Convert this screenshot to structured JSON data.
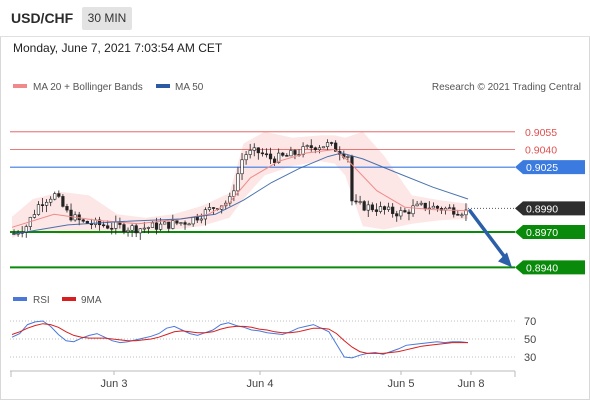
{
  "header": {
    "symbol": "USD/CHF",
    "timeframe_button": "30 MIN",
    "datetime": "Monday, June 7, 2021 7:03:54 AM CET"
  },
  "legend": {
    "ma20_label": "MA 20 + Bollinger Bands",
    "ma20_color": "#f08a8a",
    "ma50_label": "MA 50",
    "ma50_color": "#2c5aa0",
    "credit": "Research © 2021 Trading Central"
  },
  "colors": {
    "resistance": "#e05050",
    "pivot": "#3b7be0",
    "support": "#0a8a0a",
    "last_price": "#333333",
    "band_fill": "#fde2e2",
    "arrow": "#2b5fa8",
    "rsi_line": "#4a78d8",
    "rsi_ma_line": "#d81e1e"
  },
  "chart_data": [
    {
      "type": "candlestick",
      "instrument": "USD/CHF",
      "interval": "30 MIN",
      "x_ticks": [
        "Jun 3",
        "Jun 4",
        "Jun 5",
        "Jun 8"
      ],
      "ylim": [
        0.8925,
        0.9082
      ],
      "levels": [
        {
          "value": "0.9055",
          "kind": "resistance"
        },
        {
          "value": "0.9040",
          "kind": "resistance"
        },
        {
          "value": "0.9025",
          "kind": "pivot"
        },
        {
          "value": "0.8990",
          "kind": "last"
        },
        {
          "value": "0.8970",
          "kind": "support"
        },
        {
          "value": "0.8940",
          "kind": "support"
        }
      ],
      "price_path": [
        [
          0,
          0.8968
        ],
        [
          4,
          0.8975
        ],
        [
          8,
          0.8995
        ],
        [
          12,
          0.9002
        ],
        [
          16,
          0.8985
        ],
        [
          20,
          0.8978
        ],
        [
          28,
          0.8975
        ],
        [
          36,
          0.8973
        ],
        [
          44,
          0.8976
        ],
        [
          50,
          0.8979
        ],
        [
          54,
          0.8985
        ],
        [
          58,
          0.8992
        ],
        [
          62,
          0.8996
        ],
        [
          64,
          0.9015
        ],
        [
          66,
          0.9036
        ],
        [
          70,
          0.9038
        ],
        [
          74,
          0.9032
        ],
        [
          78,
          0.9034
        ],
        [
          82,
          0.9038
        ],
        [
          86,
          0.9043
        ],
        [
          90,
          0.9044
        ],
        [
          92,
          0.9041
        ],
        [
          96,
          0.9035
        ],
        [
          97,
          0.8993
        ],
        [
          100,
          0.8992
        ],
        [
          104,
          0.899
        ],
        [
          108,
          0.8987
        ],
        [
          112,
          0.8986
        ],
        [
          114,
          0.899
        ],
        [
          118,
          0.8992
        ],
        [
          122,
          0.899
        ],
        [
          126,
          0.8989
        ],
        [
          130,
          0.8987
        ]
      ],
      "ma20_path": [
        [
          0,
          0.8974
        ],
        [
          12,
          0.8985
        ],
        [
          24,
          0.898
        ],
        [
          36,
          0.8977
        ],
        [
          48,
          0.8981
        ],
        [
          56,
          0.8985
        ],
        [
          62,
          0.8995
        ],
        [
          68,
          0.9016
        ],
        [
          76,
          0.903
        ],
        [
          84,
          0.9037
        ],
        [
          92,
          0.904
        ],
        [
          96,
          0.903
        ],
        [
          104,
          0.9005
        ],
        [
          112,
          0.8991
        ],
        [
          120,
          0.8989
        ],
        [
          130,
          0.8988
        ]
      ],
      "ma50_path": [
        [
          0,
          0.8968
        ],
        [
          16,
          0.8976
        ],
        [
          32,
          0.8979
        ],
        [
          48,
          0.8981
        ],
        [
          58,
          0.8985
        ],
        [
          66,
          0.8997
        ],
        [
          74,
          0.9012
        ],
        [
          82,
          0.9024
        ],
        [
          90,
          0.9034
        ],
        [
          94,
          0.9037
        ],
        [
          100,
          0.9032
        ],
        [
          110,
          0.902
        ],
        [
          120,
          0.9008
        ],
        [
          130,
          0.8998
        ]
      ],
      "band_upper": [
        [
          0,
          0.8983
        ],
        [
          6,
          0.8998
        ],
        [
          14,
          0.9004
        ],
        [
          22,
          0.9001
        ],
        [
          30,
          0.8985
        ],
        [
          38,
          0.8982
        ],
        [
          46,
          0.8985
        ],
        [
          54,
          0.8992
        ],
        [
          62,
          0.9003
        ],
        [
          66,
          0.9045
        ],
        [
          72,
          0.9055
        ],
        [
          80,
          0.905
        ],
        [
          88,
          0.9052
        ],
        [
          92,
          0.9052
        ],
        [
          95,
          0.905
        ],
        [
          100,
          0.9055
        ],
        [
          106,
          0.9035
        ],
        [
          114,
          0.9001
        ],
        [
          122,
          0.8997
        ],
        [
          130,
          0.8994
        ]
      ],
      "band_lower": [
        [
          0,
          0.8965
        ],
        [
          6,
          0.8972
        ],
        [
          14,
          0.8968
        ],
        [
          22,
          0.8968
        ],
        [
          30,
          0.897
        ],
        [
          38,
          0.897
        ],
        [
          46,
          0.8972
        ],
        [
          54,
          0.8975
        ],
        [
          62,
          0.8982
        ],
        [
          66,
          0.8998
        ],
        [
          72,
          0.9018
        ],
        [
          80,
          0.9026
        ],
        [
          88,
          0.903
        ],
        [
          92,
          0.9028
        ],
        [
          95,
          0.9018
        ],
        [
          100,
          0.8975
        ],
        [
          106,
          0.8972
        ],
        [
          114,
          0.8977
        ],
        [
          122,
          0.898
        ],
        [
          130,
          0.8981
        ]
      ],
      "forecast_arrow": {
        "from": 0.8988,
        "to": 0.894
      }
    },
    {
      "type": "line",
      "x_ticks": [
        "Jun 3",
        "Jun 4",
        "Jun 5",
        "Jun 8"
      ],
      "y_ticks": [
        "70",
        "50",
        "30"
      ],
      "ylim": [
        20,
        80
      ],
      "series": [
        {
          "name": "RSI",
          "values": [
            52,
            56,
            66,
            69,
            70,
            64,
            55,
            48,
            47,
            51,
            54,
            56,
            52,
            48,
            46,
            47,
            49,
            51,
            53,
            56,
            62,
            64,
            60,
            56,
            54,
            57,
            60,
            66,
            68,
            65,
            63,
            60,
            59,
            57,
            56,
            55,
            58,
            62,
            64,
            66,
            62,
            58,
            44,
            30,
            29,
            32,
            34,
            35,
            33,
            36,
            39,
            43,
            44,
            45,
            46,
            47,
            46,
            47,
            47,
            46
          ]
        },
        {
          "name": "9MA",
          "values": [
            55,
            58,
            62,
            65,
            67,
            66,
            63,
            58,
            54,
            52,
            51,
            51,
            51,
            50,
            49,
            48,
            48,
            49,
            50,
            52,
            55,
            58,
            59,
            58,
            57,
            57,
            58,
            61,
            63,
            64,
            64,
            63,
            61,
            60,
            58,
            57,
            57,
            58,
            60,
            62,
            62,
            61,
            56,
            48,
            41,
            36,
            34,
            34,
            34,
            35,
            36,
            38,
            40,
            42,
            43,
            44,
            45,
            46,
            46,
            46
          ]
        }
      ]
    }
  ]
}
